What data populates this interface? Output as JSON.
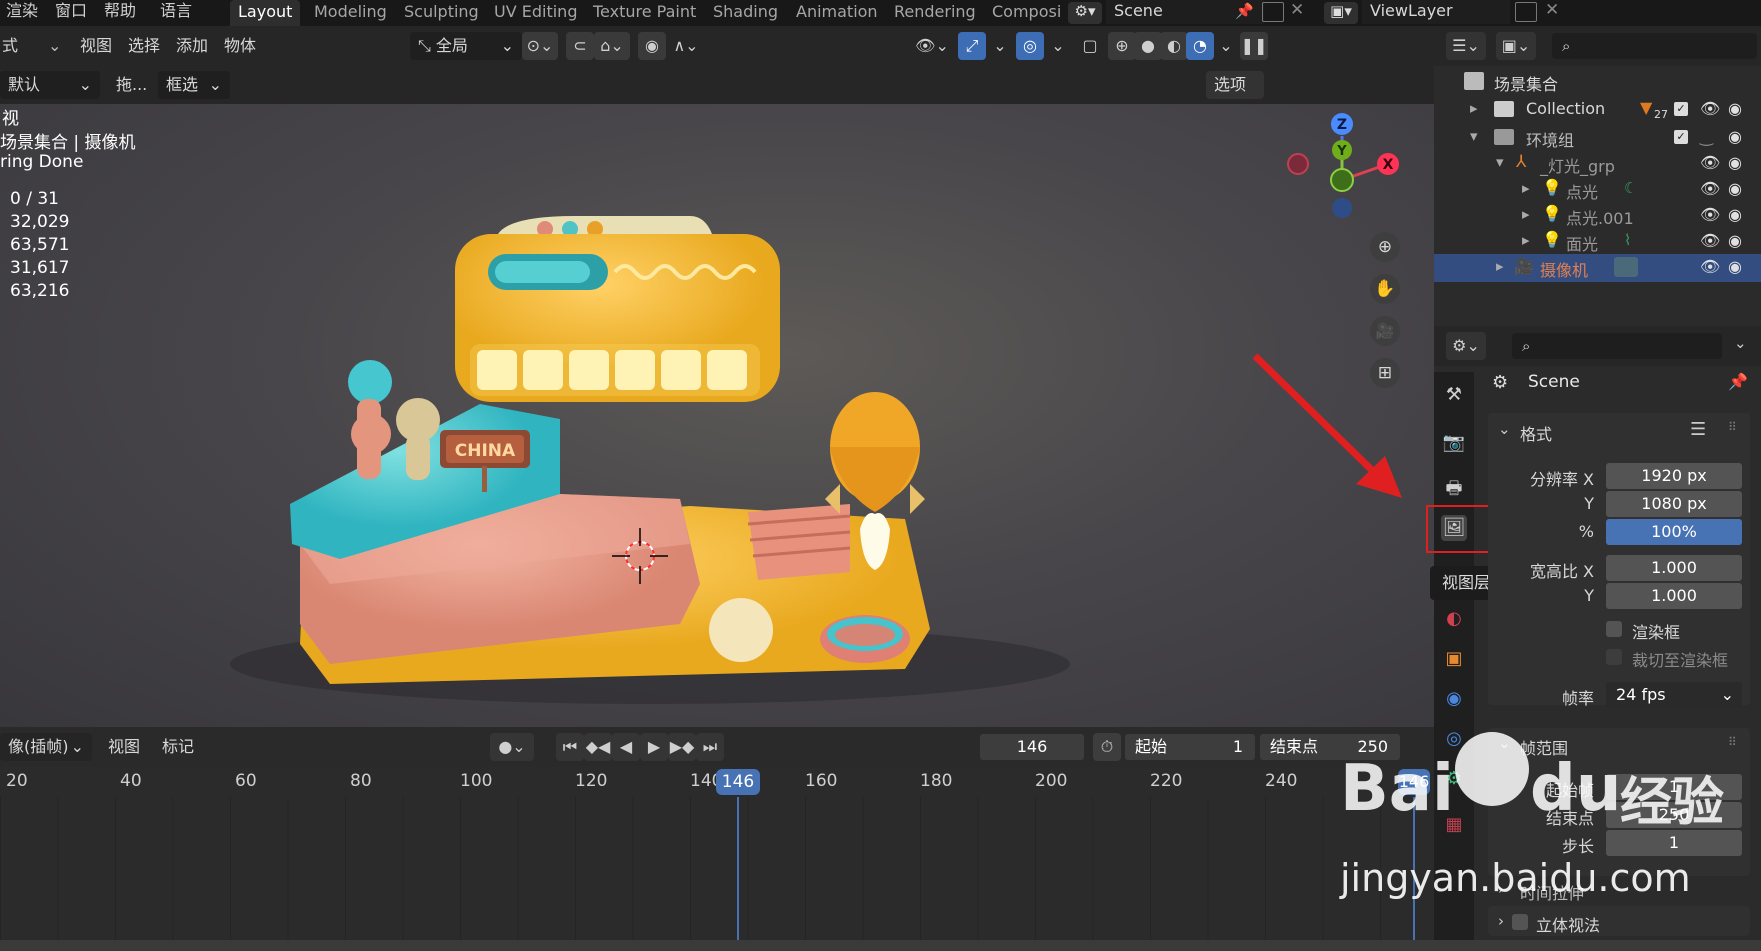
{
  "topbar": {
    "menus": [
      "渲染",
      "窗口",
      "帮助",
      "语言"
    ],
    "workspaces": [
      "Layout",
      "Modeling",
      "Sculpting",
      "UV Editing",
      "Texture Paint",
      "Shading",
      "Animation",
      "Rendering",
      "Composi"
    ],
    "scene_label": "Scene",
    "viewlayer_label": "ViewLayer"
  },
  "header1": {
    "mode_label": "式",
    "menus": [
      "视图",
      "选择",
      "添加",
      "物体"
    ],
    "transform_orientation": "全局"
  },
  "header2": {
    "orientation": "默认",
    "drag_label": "拖...",
    "select_mode": "框选",
    "options_label": "选项"
  },
  "viewport": {
    "title_line": "视",
    "scene_path": "场景集合 | 摄像机",
    "status": "ring Done",
    "stats": [
      "0 / 31",
      "32,029",
      "63,571",
      "31,617",
      "63,216"
    ],
    "sign_text": "CHINA",
    "gizmo_axes": {
      "z": "Z",
      "y": "Y",
      "x": "X"
    }
  },
  "timeline": {
    "mode": "像(插帧)",
    "menus": [
      "视图",
      "标记"
    ],
    "current_frame": "146",
    "start_label": "起始",
    "start_value": "1",
    "end_label": "结束点",
    "end_value": "250",
    "ruler_ticks": [
      "20",
      "40",
      "60",
      "80",
      "100",
      "120",
      "140",
      "160",
      "180",
      "200",
      "220",
      "240"
    ],
    "playhead_label": "146",
    "playhead_right": "146"
  },
  "outliner": {
    "items": [
      {
        "label": "场景集合"
      },
      {
        "label": "Collection",
        "badge": "27"
      },
      {
        "label": "环境组"
      },
      {
        "label": "_灯光_grp"
      },
      {
        "label": "点光"
      },
      {
        "label": "点光.001"
      },
      {
        "label": "面光"
      },
      {
        "label": "摄像机"
      }
    ]
  },
  "properties": {
    "context": "Scene",
    "tooltip": "视图层属性",
    "format_panel": {
      "title": "格式",
      "res_x_label": "分辨率 X",
      "res_x": "1920 px",
      "res_y_label": "Y",
      "res_y": "1080 px",
      "pct_label": "%",
      "pct": "100%",
      "aspect_x_label": "宽高比 X",
      "aspect_x": "1.000",
      "aspect_y_label": "Y",
      "aspect_y": "1.000",
      "border_label": "渲染框",
      "crop_label": "裁切至渲染框",
      "fps_label": "帧率",
      "fps": "24 fps"
    },
    "frame_range_panel": {
      "title": "帧范围",
      "start_label": "起始帧",
      "start": "1",
      "end_label": "结束点",
      "end": "250",
      "step_label": "步长",
      "step": "1"
    },
    "time_stretch_label": "时间拉伸",
    "stereoscopy_label": "立体视法"
  },
  "watermark": {
    "text1": "Bai",
    "text2": "du",
    "text3": "经验",
    "url": "jingyan.baidu.com"
  },
  "colors": {
    "accent_blue": "#4772b3",
    "highlight_red": "#e02020",
    "selected_row": "#334d80"
  }
}
